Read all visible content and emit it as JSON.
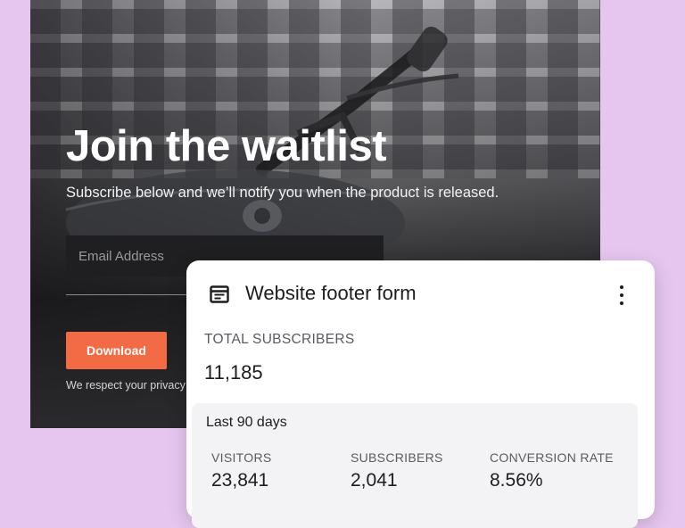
{
  "hero": {
    "title": "Join the waitlist",
    "subtitle": "Subscribe below and we’ll notify you when the product is released.",
    "email_placeholder": "Email Address",
    "download_label": "Download",
    "privacy_text": "We respect your privacy"
  },
  "card": {
    "icon": "form-icon",
    "title": "Website footer form",
    "menu_icon": "more-vertical-icon",
    "total_label": "TOTAL SUBSCRIBERS",
    "total_value": "11,185",
    "range_label": "Last 90 days",
    "stats": [
      {
        "label": "VISITORS",
        "value": "23,841"
      },
      {
        "label": "SUBSCRIBERS",
        "value": "2,041"
      },
      {
        "label": "CONVERSION RATE",
        "value": "8.56%"
      }
    ]
  },
  "colors": {
    "background": "#e6c6ef",
    "accent": "#f26b45",
    "card": "#ffffff",
    "input": "#1f1f21"
  }
}
